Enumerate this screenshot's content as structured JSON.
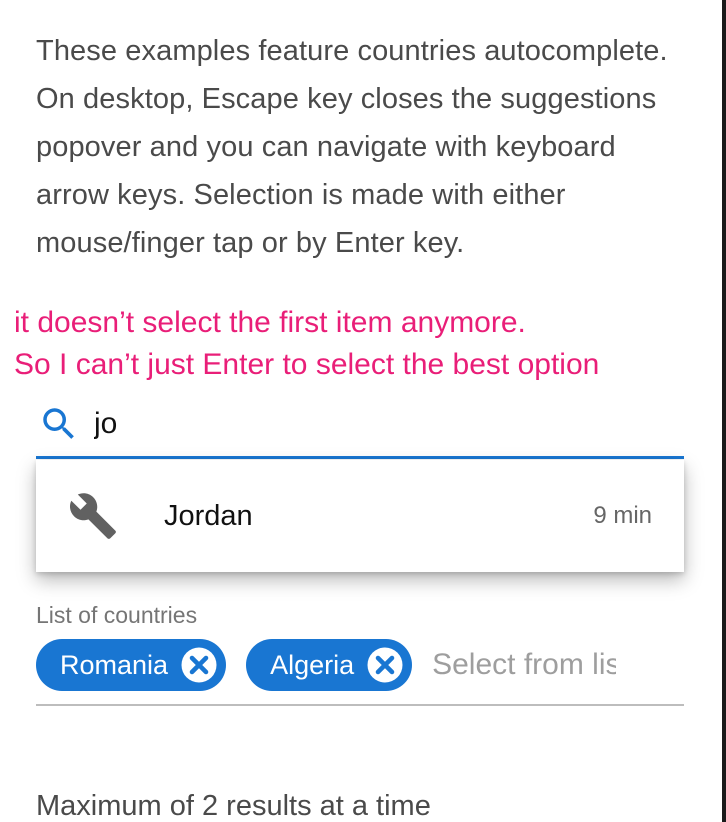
{
  "intro": {
    "line1": "These examples feature countries autocomplete.",
    "line2": "On desktop, Escape key closes the suggestions popover and you can navigate with keyboard arrow keys. Selection is made with either mouse/finger tap or by Enter key."
  },
  "annotation": {
    "line1": "it doesn’t select the first item anymore.",
    "line2": "So I can’t just Enter to select the best option"
  },
  "search": {
    "icon": "search-icon",
    "value": "jo"
  },
  "popover": {
    "items": [
      {
        "icon": "wrench-icon",
        "label": "Jordan",
        "caption": "9 min"
      }
    ]
  },
  "countries_field": {
    "label": "List of countries",
    "chips": [
      {
        "label": "Romania",
        "remove_icon": "close-circle-icon"
      },
      {
        "label": "Algeria",
        "remove_icon": "close-circle-icon"
      }
    ],
    "placeholder": "Select from list"
  },
  "footer": {
    "text": "Maximum of 2 results at a time"
  },
  "colors": {
    "primary": "#1976d2",
    "annotation": "#e91e78",
    "text": "#4a4a4a",
    "muted": "#757575"
  }
}
